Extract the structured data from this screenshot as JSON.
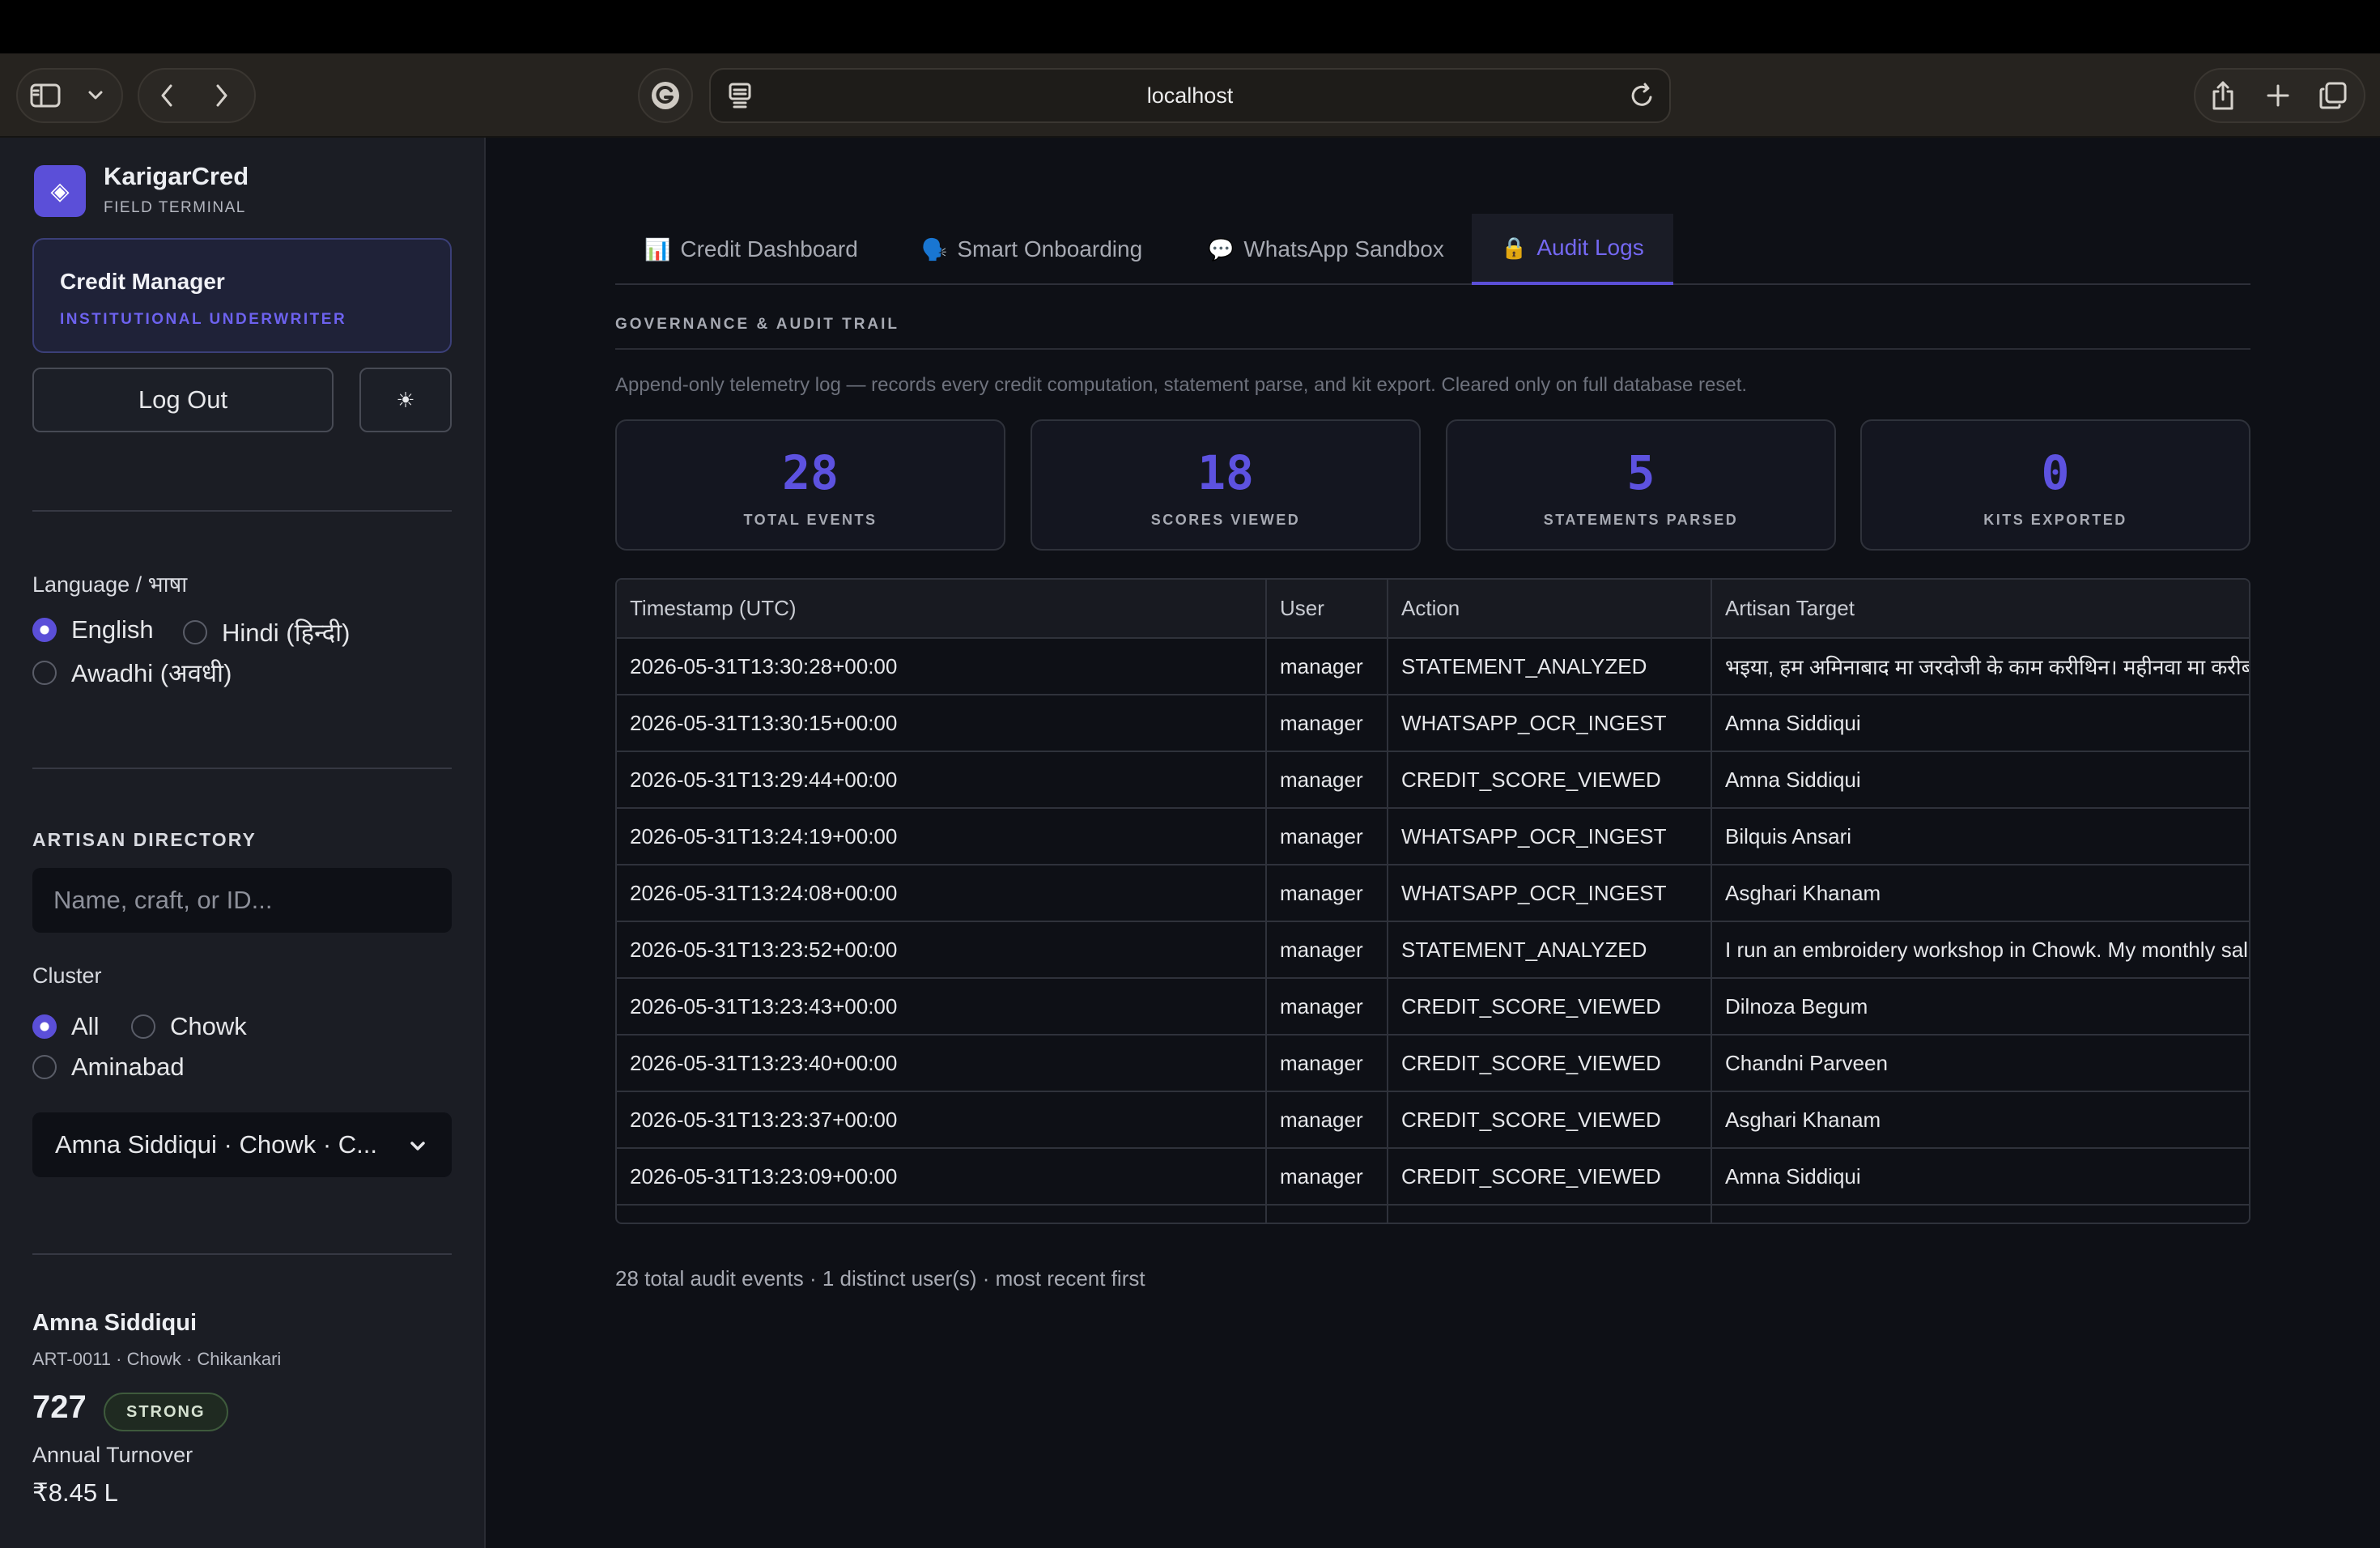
{
  "browser": {
    "url": "localhost"
  },
  "sidebar": {
    "brand": "KarigarCred",
    "brand_sub": "FIELD TERMINAL",
    "role_title": "Credit Manager",
    "role_sub": "INSTITUTIONAL UNDERWRITER",
    "logout_label": "Log Out",
    "theme_icon": "☀",
    "language_label": "Language / भाषा",
    "languages": [
      {
        "label": "English",
        "selected": true
      },
      {
        "label": "Hindi (हिन्दी)",
        "selected": false
      },
      {
        "label": "Awadhi (अवधी)",
        "selected": false
      }
    ],
    "directory_heading": "ARTISAN DIRECTORY",
    "search_placeholder": "Name, craft, or ID...",
    "cluster_label": "Cluster",
    "clusters": [
      {
        "label": "All",
        "selected": true
      },
      {
        "label": "Chowk",
        "selected": false
      },
      {
        "label": "Aminabad",
        "selected": false
      }
    ],
    "artisan_select": "Amna Siddiqui · Chowk · C...",
    "artisan": {
      "name": "Amna Siddiqui",
      "meta": "ART-0011 · Chowk · Chikankari",
      "score": "727",
      "badge": "STRONG",
      "turnover_label": "Annual Turnover",
      "turnover_value": "₹8.45 L"
    }
  },
  "tabs": [
    {
      "icon": "📊",
      "label": "Credit Dashboard",
      "active": false
    },
    {
      "icon": "🗣️",
      "label": "Smart Onboarding",
      "active": false
    },
    {
      "icon": "💬",
      "label": "WhatsApp Sandbox",
      "active": false
    },
    {
      "icon": "🔒",
      "label": "Audit Logs",
      "active": true
    }
  ],
  "section": {
    "heading": "GOVERNANCE & AUDIT TRAIL",
    "description": "Append-only telemetry log — records every credit computation, statement parse, and kit export. Cleared only on full database reset."
  },
  "kpis": [
    {
      "value": "28",
      "label": "TOTAL EVENTS"
    },
    {
      "value": "18",
      "label": "SCORES VIEWED"
    },
    {
      "value": "5",
      "label": "STATEMENTS PARSED"
    },
    {
      "value": "0",
      "label": "KITS EXPORTED"
    }
  ],
  "table": {
    "columns": [
      "Timestamp (UTC)",
      "User",
      "Action",
      "Artisan Target"
    ],
    "rows": [
      [
        "2026-05-31T13:30:28+00:00",
        "manager",
        "STATEMENT_ANALYZED",
        "भइया, हम अमिनाबाद मा जरदोजी के काम करीथिन। महीनवा मा करीब"
      ],
      [
        "2026-05-31T13:30:15+00:00",
        "manager",
        "WHATSAPP_OCR_INGEST",
        "Amna Siddiqui"
      ],
      [
        "2026-05-31T13:29:44+00:00",
        "manager",
        "CREDIT_SCORE_VIEWED",
        "Amna Siddiqui"
      ],
      [
        "2026-05-31T13:24:19+00:00",
        "manager",
        "WHATSAPP_OCR_INGEST",
        "Bilquis Ansari"
      ],
      [
        "2026-05-31T13:24:08+00:00",
        "manager",
        "WHATSAPP_OCR_INGEST",
        "Asghari Khanam"
      ],
      [
        "2026-05-31T13:23:52+00:00",
        "manager",
        "STATEMENT_ANALYZED",
        "I run an embroidery workshop in Chowk. My monthly sales"
      ],
      [
        "2026-05-31T13:23:43+00:00",
        "manager",
        "CREDIT_SCORE_VIEWED",
        "Dilnoza Begum"
      ],
      [
        "2026-05-31T13:23:40+00:00",
        "manager",
        "CREDIT_SCORE_VIEWED",
        "Chandni Parveen"
      ],
      [
        "2026-05-31T13:23:37+00:00",
        "manager",
        "CREDIT_SCORE_VIEWED",
        "Asghari Khanam"
      ],
      [
        "2026-05-31T13:23:09+00:00",
        "manager",
        "CREDIT_SCORE_VIEWED",
        "Amna Siddiqui"
      ]
    ]
  },
  "footer": "28 total audit events · 1 distinct user(s) · most recent first"
}
